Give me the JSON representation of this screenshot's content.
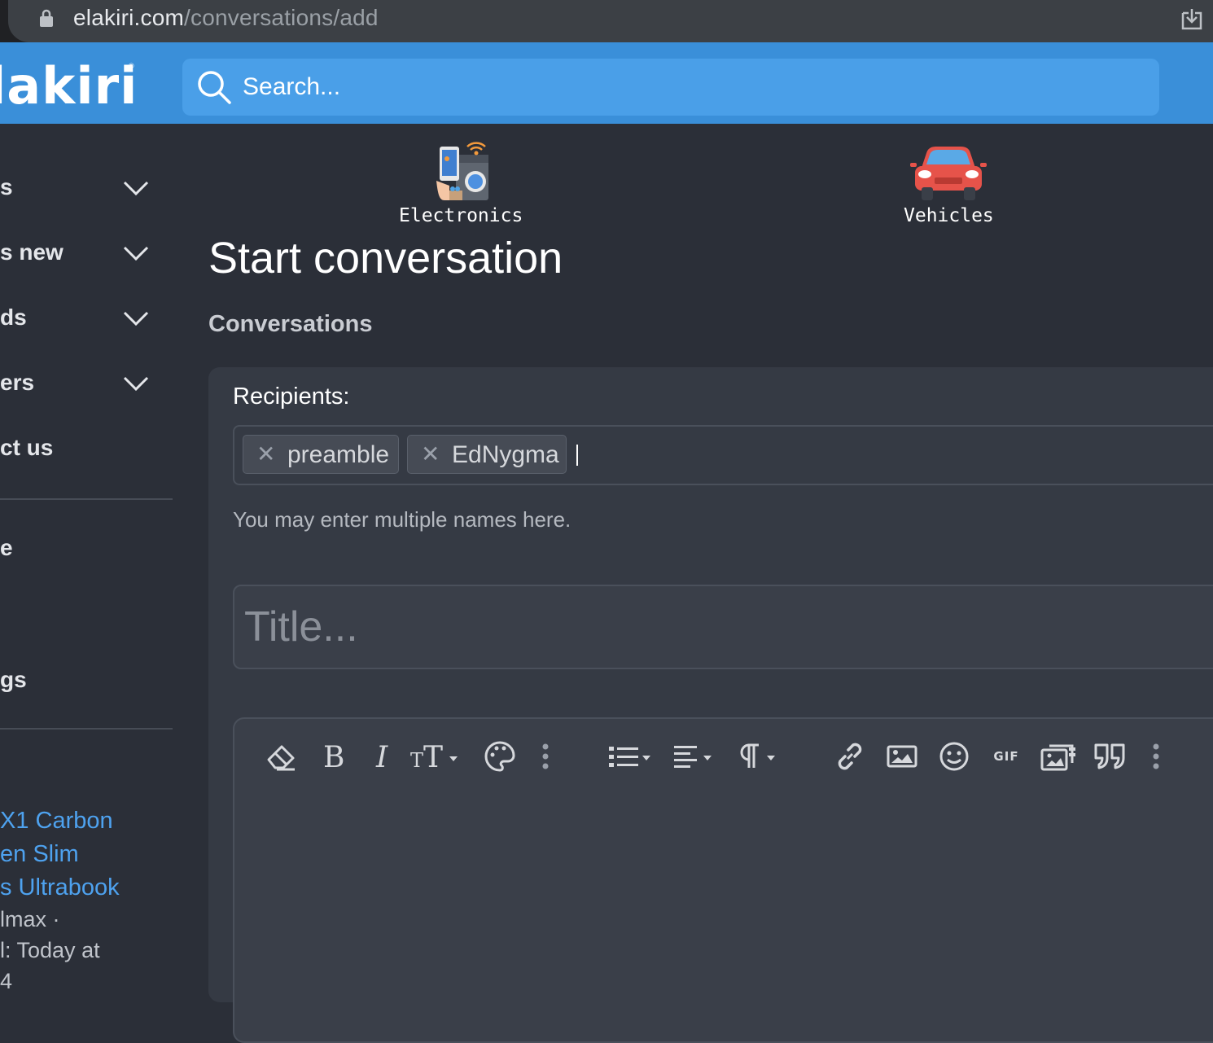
{
  "browser": {
    "url_host": "elakiri.com",
    "url_path": "/conversations/add"
  },
  "header": {
    "logo_text": "lakiri",
    "search_placeholder": "Search..."
  },
  "sidebar": {
    "nav_items": [
      {
        "label": "s",
        "has_chevron": true
      },
      {
        "label": "s new",
        "has_chevron": true
      },
      {
        "label": "ds",
        "has_chevron": true
      },
      {
        "label": "ers",
        "has_chevron": true
      },
      {
        "label": "ct us",
        "has_chevron": false
      }
    ],
    "extra_items": [
      "e",
      "gs"
    ],
    "thread_links": [
      "X1 Carbon",
      "en Slim",
      "s Ultrabook"
    ],
    "thread_meta": [
      "lmax ·",
      "l: Today at",
      "4"
    ]
  },
  "categories": [
    {
      "label": "Electronics",
      "icon": "electronics-icon"
    },
    {
      "label": "Vehicles",
      "icon": "car-icon"
    }
  ],
  "page": {
    "title": "Start conversation",
    "breadcrumb": "Conversations"
  },
  "form": {
    "recipients_label": "Recipients:",
    "recipients": [
      "preamble",
      "EdNygma"
    ],
    "recipients_hint": "You may enter multiple names here.",
    "title_placeholder": "Title...",
    "toolbar": [
      "eraser",
      "bold",
      "italic",
      "font-size",
      "color-palette",
      "more-options",
      "list",
      "align",
      "paragraph",
      "link",
      "image",
      "emoji",
      "gif",
      "media",
      "quote",
      "more-options"
    ],
    "gif_label": "GIF"
  },
  "colors": {
    "header_blue": "#3a8fd9",
    "search_blue": "#4a9fe8",
    "link_blue": "#4ea2ef",
    "page_bg": "#2b2f38",
    "panel_bg": "#353a44"
  }
}
